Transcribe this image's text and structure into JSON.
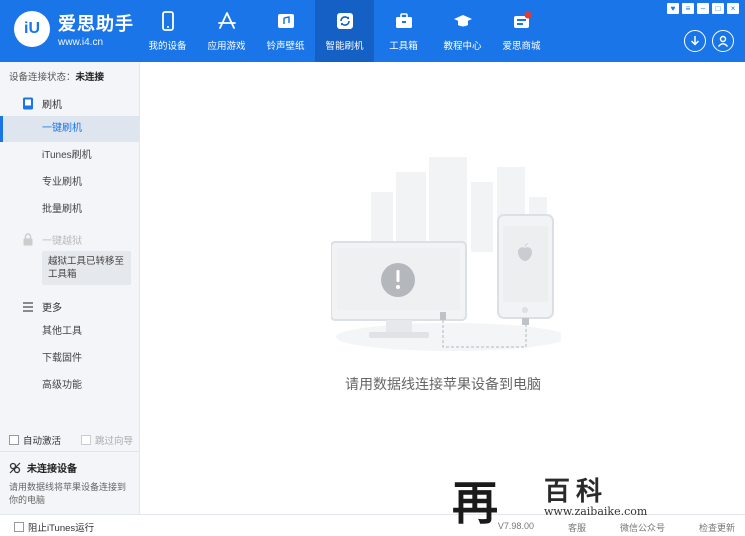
{
  "app": {
    "name": "爱思助手",
    "url": "www.i4.cn",
    "logo_mark": "iU"
  },
  "nav": [
    {
      "label": "我的设备",
      "icon": "phone-icon",
      "active": false
    },
    {
      "label": "应用游戏",
      "icon": "app-store-icon",
      "active": false
    },
    {
      "label": "铃声壁纸",
      "icon": "ringtone-icon",
      "active": false
    },
    {
      "label": "智能刷机",
      "icon": "refresh-icon",
      "active": true
    },
    {
      "label": "工具箱",
      "icon": "toolbox-icon",
      "active": false
    },
    {
      "label": "教程中心",
      "icon": "graduation-cap-icon",
      "active": false
    },
    {
      "label": "爱思商城",
      "icon": "shop-icon",
      "active": false
    }
  ],
  "window_controls": [
    "♥",
    "≡",
    "–",
    "□",
    "×"
  ],
  "sidebar": {
    "status_label": "设备连接状态：",
    "status_value": "未连接",
    "flash_head": "刷机",
    "items": [
      "一键刷机",
      "iTunes刷机",
      "专业刷机",
      "批量刷机"
    ],
    "jailbreak_label": "一键越狱",
    "notice": "越狱工具已转移至工具箱",
    "more_head": "更多",
    "more_items": [
      "其他工具",
      "下载固件",
      "高级功能"
    ],
    "auto_activate": "自动激活",
    "skip_guide": "跳过向导",
    "device_title": "未连接设备",
    "device_desc": "请用数据线将苹果设备连接到你的电脑"
  },
  "main": {
    "message": "请用数据线连接苹果设备到电脑"
  },
  "bottom": {
    "block_itunes": "阻止iTunes运行",
    "right_items": [
      "V7.98.00",
      "客服",
      "微信公众号",
      "检查更新"
    ]
  },
  "watermark": {
    "glyph": "再",
    "name": "百科",
    "url": "www.zaibaike.com"
  },
  "colors": {
    "brand": "#1a76e8",
    "active_nav": "#1460c4",
    "sidebar_bg": "#f3f5f8"
  }
}
